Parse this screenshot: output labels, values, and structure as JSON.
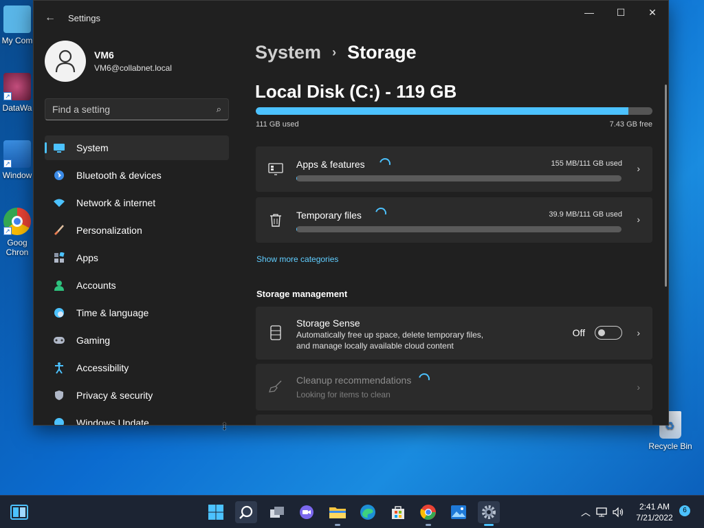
{
  "desktop": {
    "icons": [
      {
        "label": "My Com"
      },
      {
        "label": "DataWa"
      },
      {
        "label": "Window"
      },
      {
        "label": "Goog Chron"
      },
      {
        "label": "Recycle Bin"
      }
    ]
  },
  "window": {
    "title": "Settings",
    "controls": {
      "minimize": "—",
      "maximize": "☐",
      "close": "✕"
    }
  },
  "user": {
    "name": "VM6",
    "email": "VM6@collabnet.local"
  },
  "search": {
    "placeholder": "Find a setting"
  },
  "sidebar": {
    "items": [
      {
        "label": "System",
        "icon": "monitor-icon",
        "color": "#4cc2ff"
      },
      {
        "label": "Bluetooth & devices",
        "icon": "bluetooth-icon",
        "color": "#3b8be8"
      },
      {
        "label": "Network & internet",
        "icon": "wifi-icon",
        "color": "#4cc2ff"
      },
      {
        "label": "Personalization",
        "icon": "brush-icon",
        "color": "#e8a060"
      },
      {
        "label": "Apps",
        "icon": "apps-icon",
        "color": "#b0b8c8"
      },
      {
        "label": "Accounts",
        "icon": "person-icon",
        "color": "#2ec27e"
      },
      {
        "label": "Time & language",
        "icon": "globe-clock-icon",
        "color": "#4cc2ff"
      },
      {
        "label": "Gaming",
        "icon": "gamepad-icon",
        "color": "#b0b8c8"
      },
      {
        "label": "Accessibility",
        "icon": "accessibility-icon",
        "color": "#4cc2ff"
      },
      {
        "label": "Privacy & security",
        "icon": "shield-icon",
        "color": "#b0b8c8"
      },
      {
        "label": "Windows Update",
        "icon": "update-icon",
        "color": "#4cc2ff"
      }
    ]
  },
  "main": {
    "breadcrumb": {
      "parent": "System",
      "separator": "›",
      "current": "Storage"
    },
    "disk": {
      "title": "Local Disk (C:) - 119 GB",
      "used": "111 GB used",
      "free": "7.43 GB free",
      "used_fraction": 0.94
    },
    "categories": [
      {
        "title": "Apps & features",
        "usage": "155 MB/111 GB used",
        "fraction": 0.002
      },
      {
        "title": "Temporary files",
        "usage": "39.9 MB/111 GB used",
        "fraction": 0.0005
      }
    ],
    "show_more": "Show more categories",
    "management_heading": "Storage management",
    "storage_sense": {
      "title": "Storage Sense",
      "desc_line1": "Automatically free up space, delete temporary files,",
      "desc_line2": "and manage locally available cloud content",
      "toggle_label": "Off"
    },
    "cleanup": {
      "title": "Cleanup recommendations",
      "desc": "Looking for items to clean"
    }
  },
  "taskbar": {
    "time": "2:41 AM",
    "date": "7/21/2022",
    "notifications": "6"
  }
}
